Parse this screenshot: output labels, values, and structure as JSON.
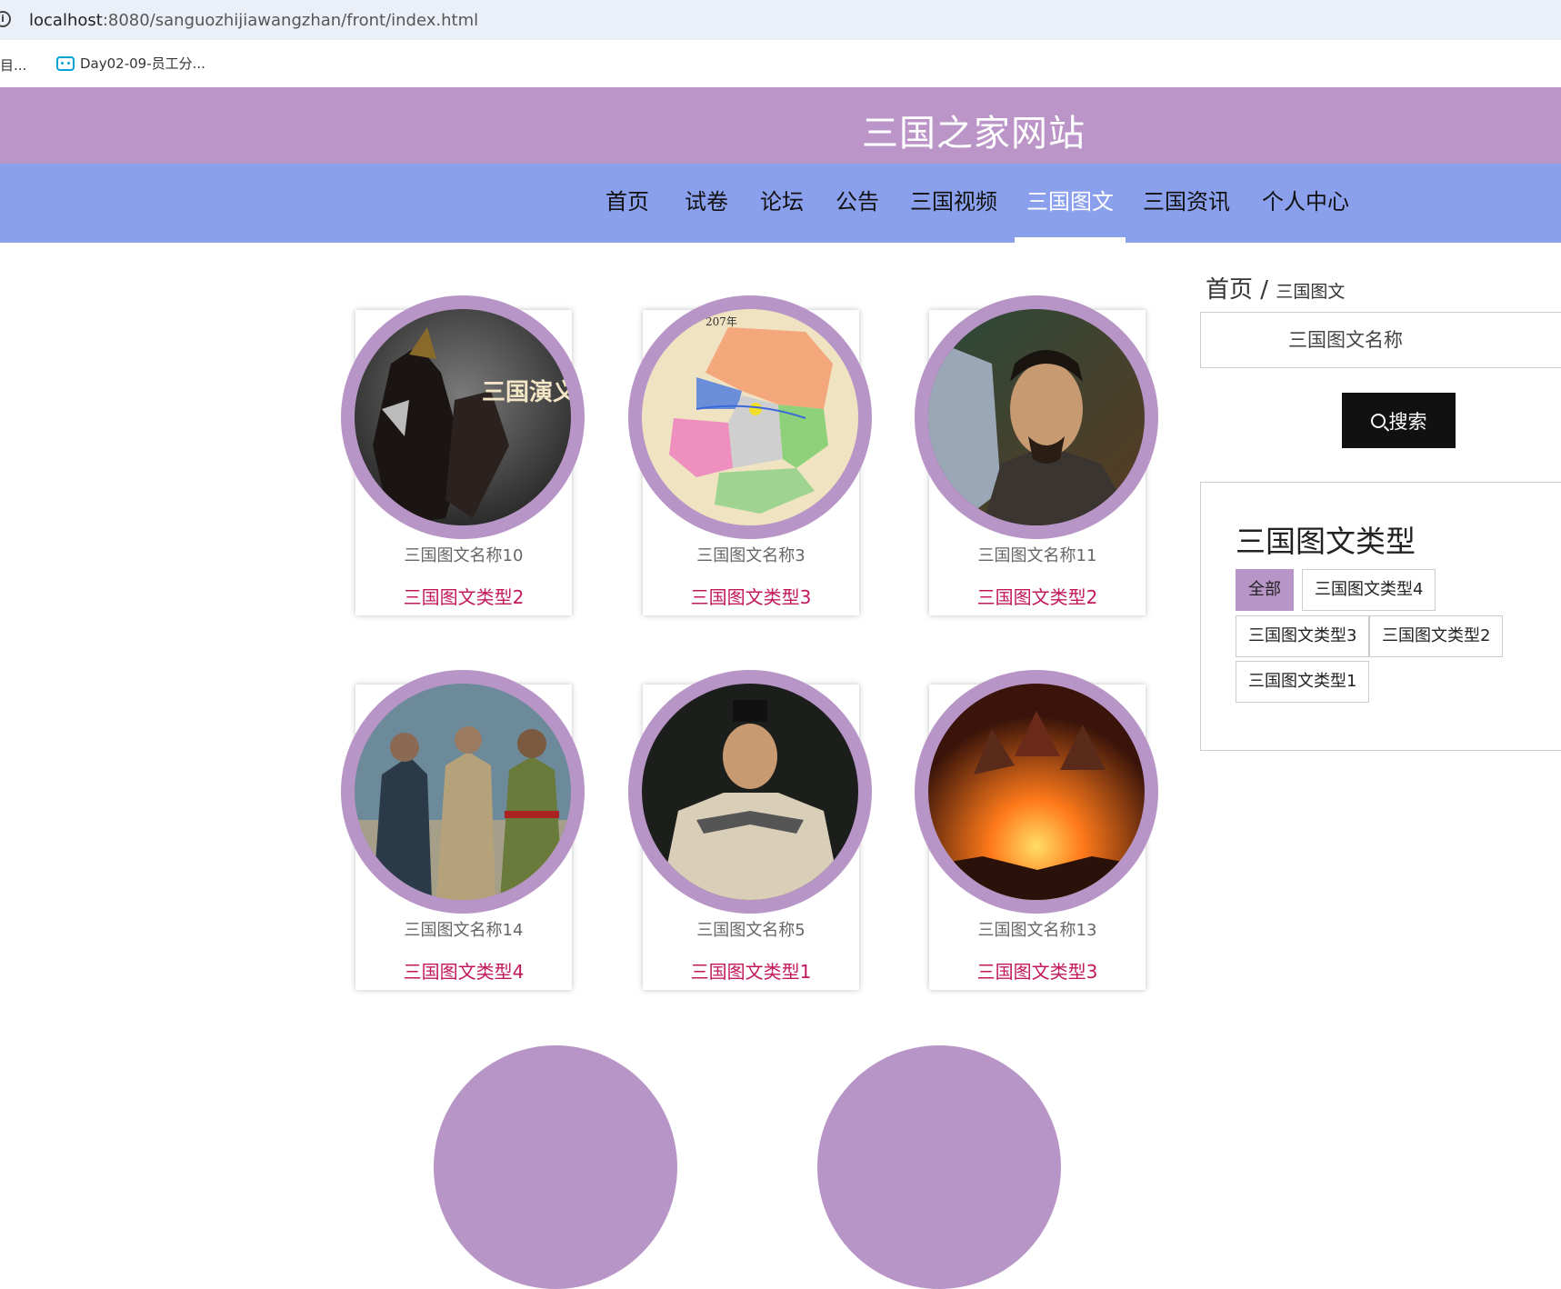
{
  "browser": {
    "url_host": "localhost",
    "url_rest": ":8080/sanguozhijiawangzhan/front/index.html",
    "bookmarks": [
      "目...",
      "Day02-09-员工分..."
    ]
  },
  "site": {
    "title": "三国之家网站"
  },
  "nav": {
    "items": [
      "首页",
      "试卷",
      "论坛",
      "公告",
      "三国视频",
      "三国图文",
      "三国资讯",
      "个人中心"
    ],
    "active": "三国图文"
  },
  "cards": [
    {
      "name": "三国图文名称10",
      "type": "三国图文类型2"
    },
    {
      "name": "三国图文名称3",
      "type": "三国图文类型3"
    },
    {
      "name": "三国图文名称11",
      "type": "三国图文类型2"
    },
    {
      "name": "三国图文名称14",
      "type": "三国图文类型4"
    },
    {
      "name": "三国图文名称5",
      "type": "三国图文类型1"
    },
    {
      "name": "三国图文名称13",
      "type": "三国图文类型3"
    }
  ],
  "image_texts": {
    "card1": "三国演义",
    "card2_year": "207年"
  },
  "breadcrumb": {
    "home": "首页",
    "separator": "/",
    "current": "三国图文"
  },
  "search": {
    "placeholder": "三国图文名称",
    "button": "搜索"
  },
  "type_filter": {
    "title": "三国图文类型",
    "tags": [
      "全部",
      "三国图文类型4",
      "三国图文类型3",
      "三国图文类型2",
      "三国图文类型1"
    ],
    "active": "全部"
  },
  "colors": {
    "header": "#bb95c8",
    "nav": "#8ba0ec",
    "accent": "#b895c7",
    "type_text": "#c2185b"
  }
}
